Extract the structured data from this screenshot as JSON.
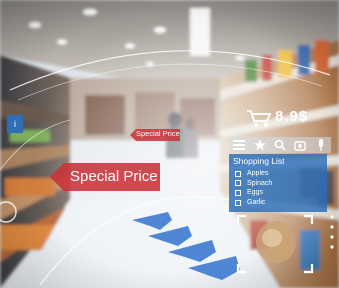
{
  "ar_overlay": {
    "special_price_label": "Special Price",
    "special_price_small_label": "Special Price",
    "price_tag": "8.9$",
    "shopping_list": {
      "title": "Shopping List",
      "items": [
        {
          "label": "Apples"
        },
        {
          "label": "Spinach"
        },
        {
          "label": "Eggs"
        },
        {
          "label": "Garlic"
        }
      ]
    },
    "toolbar_icons": [
      "menu-icon",
      "star-icon",
      "search-icon",
      "camera-icon",
      "microphone-icon"
    ],
    "colors": {
      "accent_blue": "#2f6fb6",
      "special_red": "#c8323a",
      "chevron_blue": "#3e7bd0"
    }
  }
}
